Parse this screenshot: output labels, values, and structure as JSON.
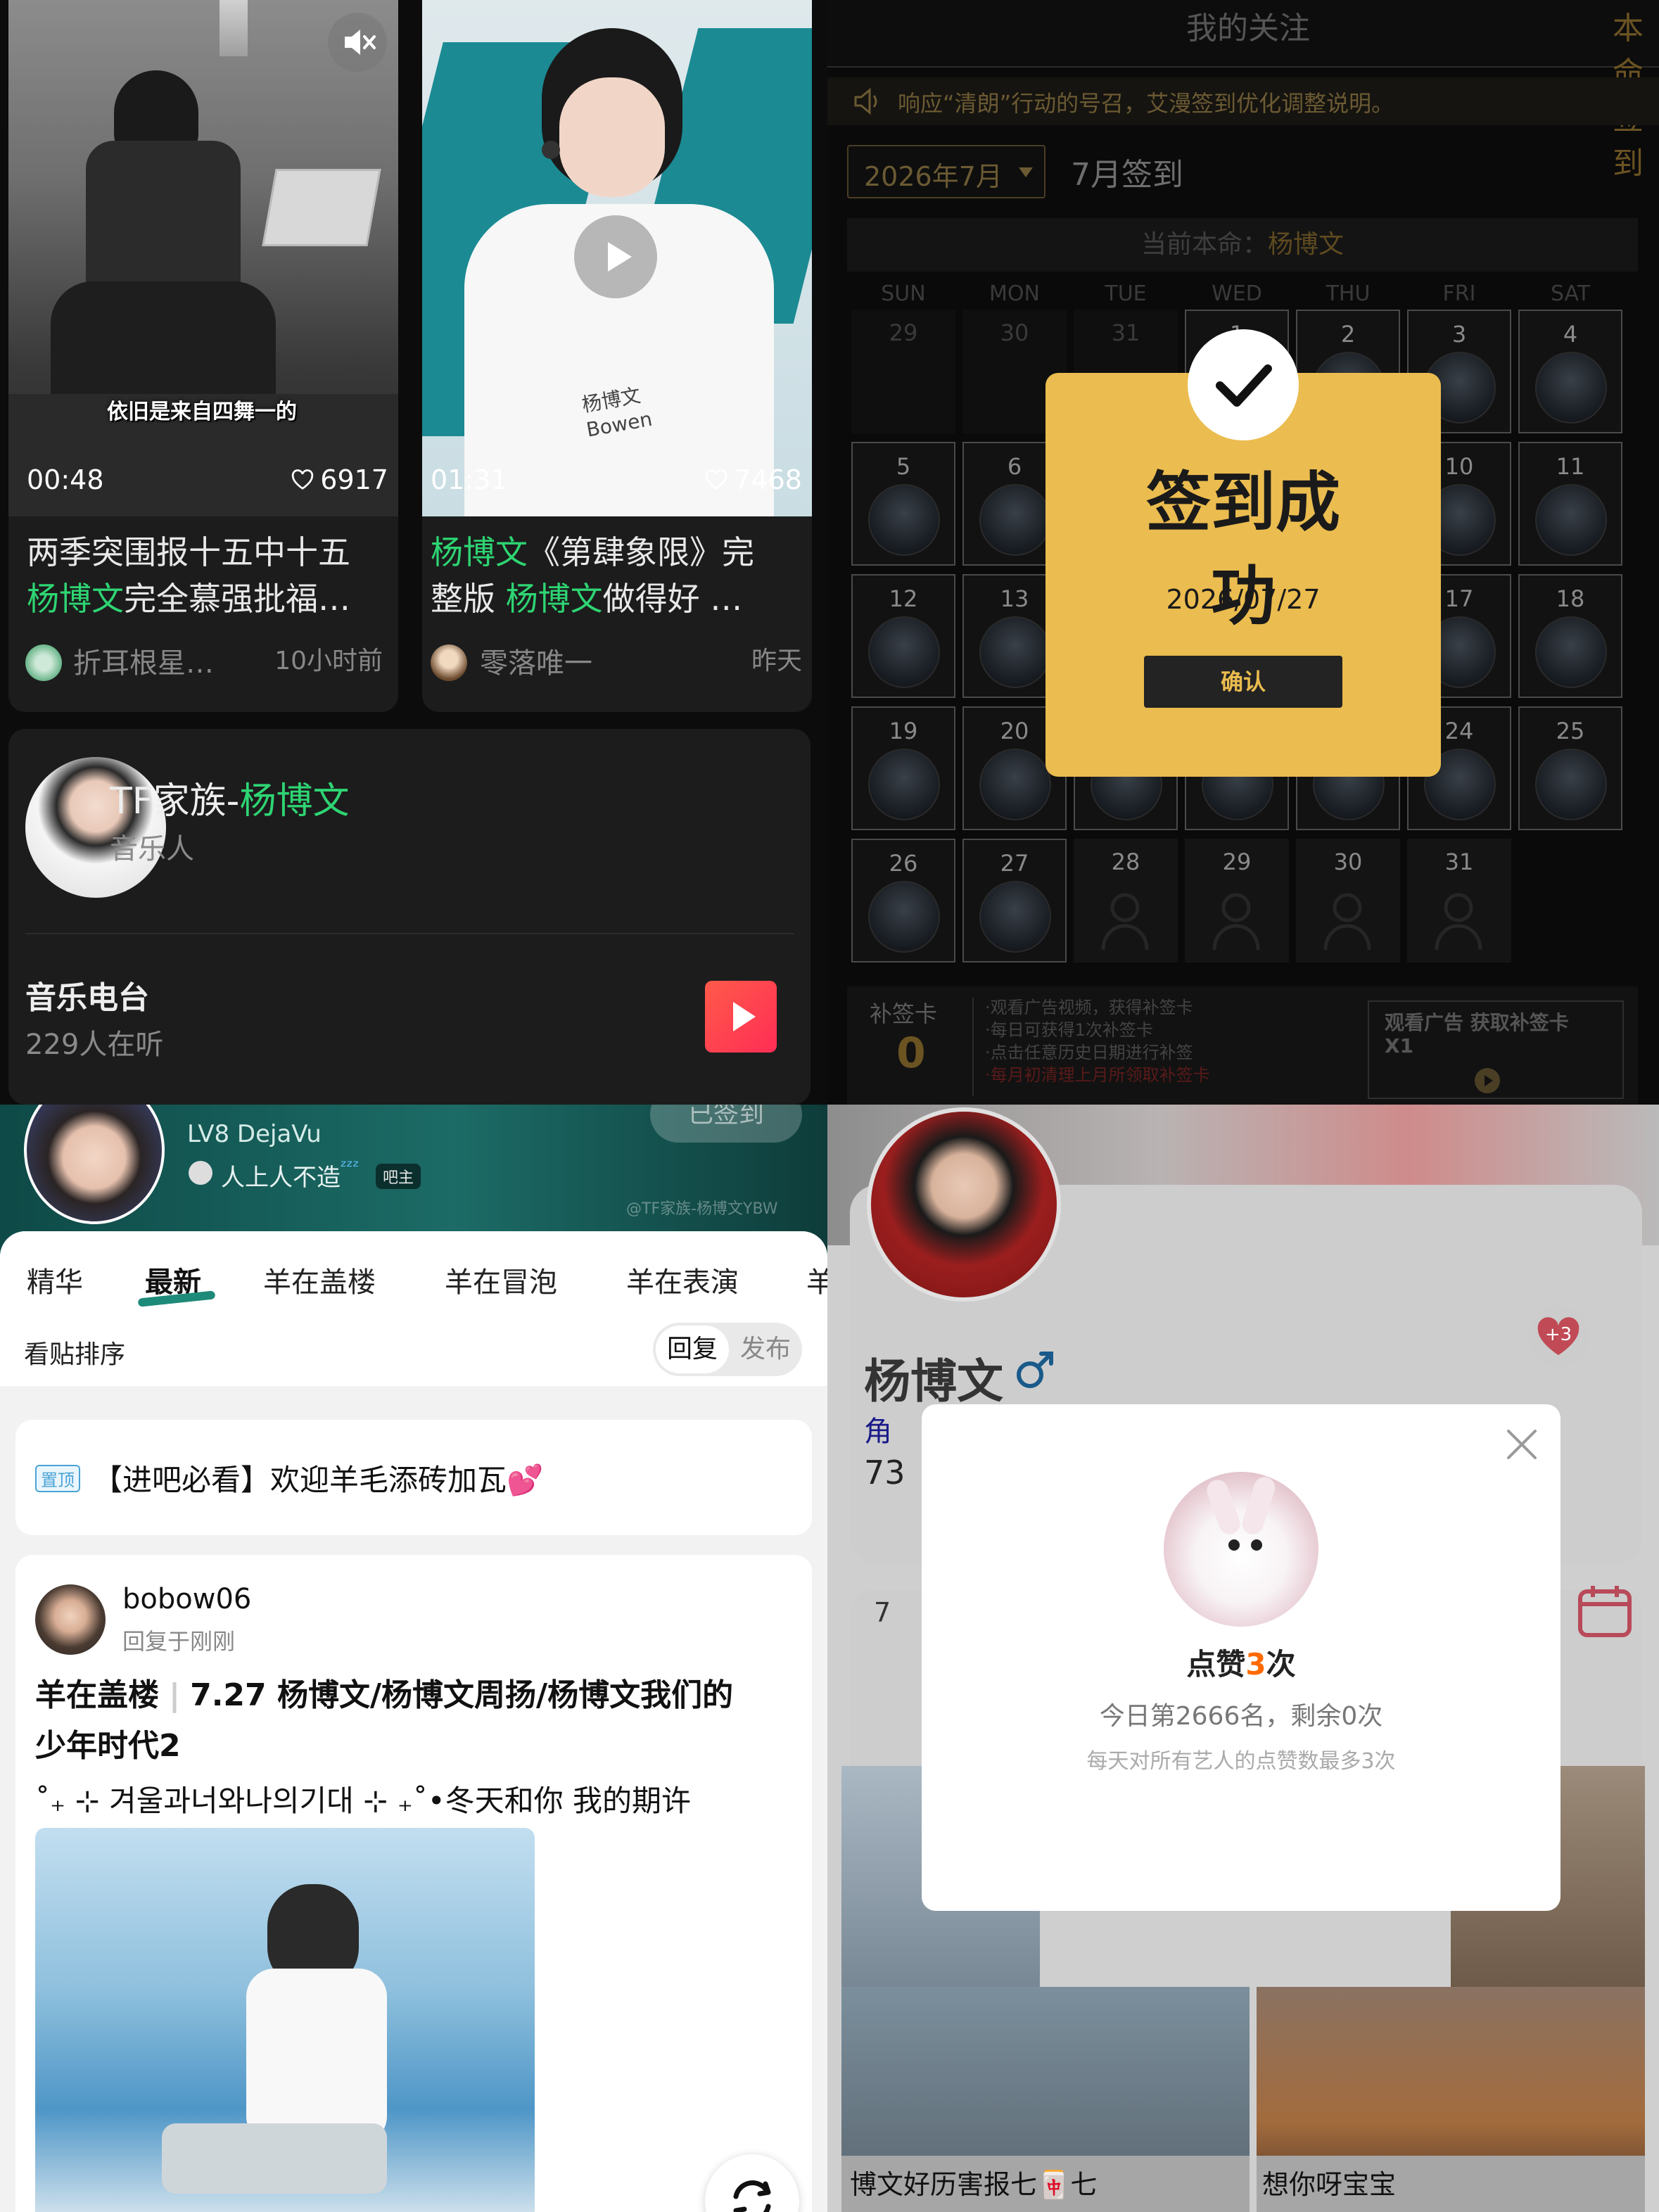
{
  "q1": {
    "video1": {
      "caption": "依旧是来自四舞一的",
      "duration": "00:48",
      "likes": "6917",
      "title_line1": "两季突围报十五中十五",
      "title_hl": "杨博文",
      "title_line2_rest": "完全慕强批福…",
      "author": "折耳根星…",
      "time": "10小时前",
      "mute_icon": "mute-icon"
    },
    "video2": {
      "duration": "01:31",
      "likes": "7468",
      "title_hl1": "杨博文",
      "title_rest1": "《第肆象限》完",
      "title_pre2": "整版 ",
      "title_hl2": "杨博文",
      "title_rest2": "做得好 …",
      "author": "零落唯一",
      "time": "昨天",
      "shirt_text1": "杨博文",
      "shirt_text2": "Bowen"
    },
    "artist": {
      "name_prefix": "TF家族-",
      "name_hl": "杨博文",
      "role": "音乐人"
    },
    "radio": {
      "title": "音乐电台",
      "listeners": "229人在听"
    }
  },
  "q2": {
    "tabs": [
      "我的关注",
      "本命签到"
    ],
    "notice": "响应“清朗”行动的号召，艾漫签到优化调整说明。",
    "month_select": "2026年7月",
    "month_label": "7月签到",
    "current_label": "当前本命：",
    "current_name": "杨博文",
    "weekdays": [
      "SUN",
      "MON",
      "TUE",
      "WED",
      "THU",
      "FRI",
      "SAT"
    ],
    "modal": {
      "title": "签到成功",
      "date": "2026/07/27",
      "button": "确认"
    },
    "makeup": {
      "label": "补签卡",
      "count": "0",
      "rules": [
        "·观看广告视频，获得补签卡",
        "·每日可获得1次补签卡",
        "·点击任意历史日期进行补签",
        "·每月初清理上月所领取补签卡"
      ],
      "ad_title": "观看广告 获取补签卡",
      "ad_count": "X1"
    }
  },
  "q3": {
    "user": {
      "level": "LV8 DejaVu",
      "motto": "人上人不造",
      "badge": "吧主",
      "signed": "已签到",
      "watermark": "@TF家族-杨博文YBW"
    },
    "tabs": [
      "精华",
      "最新",
      "羊在盖楼",
      "羊在冒泡",
      "羊在表演",
      "羊"
    ],
    "sort": {
      "label": "看贴排序",
      "opt1": "回复",
      "opt2": "发布"
    },
    "pinned": {
      "tag": "置顶",
      "text": "【进吧必看】欢迎羊毛添砖加瓦💕"
    },
    "post": {
      "author": "bobow06",
      "time": "回复于刚刚",
      "category": "羊在盖楼",
      "title1": "7.27 杨博文/杨博文周扬/杨博文我们的",
      "title2": "少年时代2",
      "body": "˚₊ ⊹ 겨울과너와나의기대 ⊹ ₊˚•冬天和你 我的期许"
    }
  },
  "q4": {
    "profile": {
      "name": "杨博文",
      "gender_icon": "male-icon",
      "like_badge": "+3",
      "role_prefix": "角",
      "num_prefix": "73",
      "row_prefix": "7"
    },
    "modal": {
      "title_pre": "点赞",
      "count": "3",
      "title_post": "次",
      "rank": "今日第2666名，剩余0次",
      "rule": "每天对所有艺人的点赞数最多3次"
    },
    "captions": [
      "博文好历害报七🀄七",
      "想你呀宝宝"
    ]
  },
  "colors": {
    "green": "#2ed573",
    "gold": "#e8b64c",
    "orange": "#ff6a00"
  }
}
